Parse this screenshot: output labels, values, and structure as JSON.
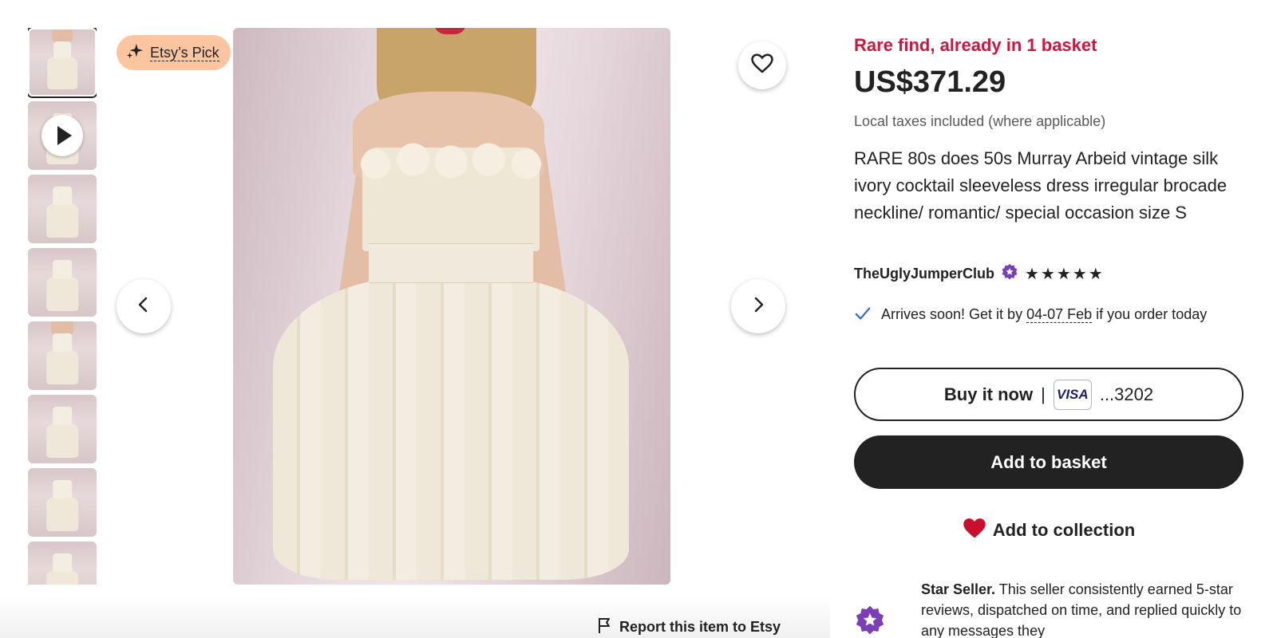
{
  "thumbnails": [
    {
      "kind": "image",
      "selected": true
    },
    {
      "kind": "video",
      "selected": false
    },
    {
      "kind": "image",
      "selected": false
    },
    {
      "kind": "image",
      "selected": false
    },
    {
      "kind": "image",
      "selected": false
    },
    {
      "kind": "image",
      "selected": false
    },
    {
      "kind": "image",
      "selected": false
    },
    {
      "kind": "image",
      "selected": false
    }
  ],
  "gallery": {
    "badge_label": "Etsy’s Pick",
    "report_label": "Report this item to Etsy"
  },
  "listing": {
    "scarcity": "Rare find, already in 1 basket",
    "price": "US$371.29",
    "tax_note": "Local taxes included (where applicable)",
    "title": "RARE 80s does 50s Murray Arbeid vintage silk ivory cocktail sleeveless dress irregular brocade neckline/ romantic/ special occasion size S",
    "shop_name": "TheUglyJumperClub",
    "rating_stars": 5
  },
  "delivery": {
    "prefix": "Arrives soon! Get it by ",
    "date_range": "04-07 Feb",
    "suffix": " if you order today"
  },
  "actions": {
    "buy_now_label": "Buy it now",
    "separator": "|",
    "card_brand": "VISA",
    "card_last4": "...3202",
    "add_to_basket_label": "Add to basket",
    "add_to_collection_label": "Add to collection"
  },
  "star_seller": {
    "heading": "Star Seller.",
    "text": " This seller consistently earned 5-star reviews, dispatched on time, and replied quickly to any messages they"
  },
  "colors": {
    "scarcity_red": "#d0153f",
    "badge_peach": "#fbc5a0",
    "check_blue": "#2f66d8",
    "heart_red": "#c8102e",
    "star_seller_purple": "#7b3fb5"
  }
}
